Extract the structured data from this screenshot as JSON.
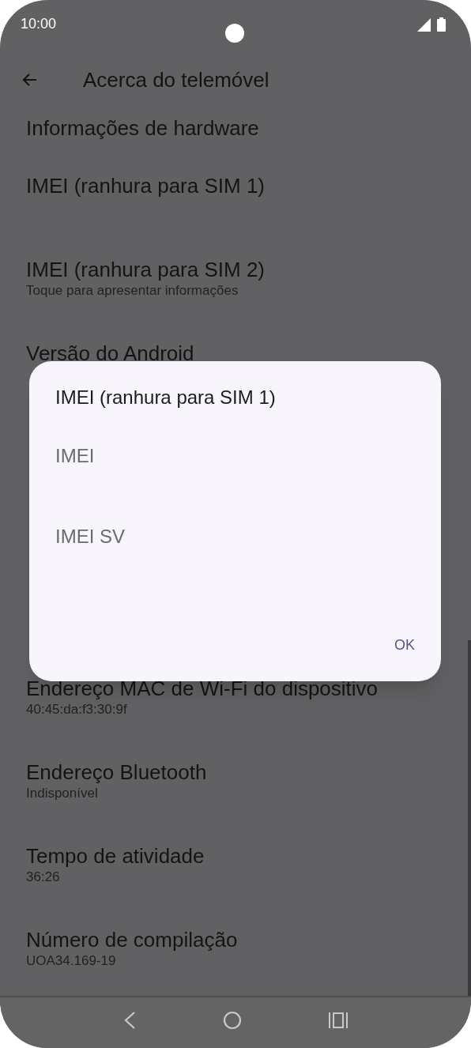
{
  "status_bar": {
    "time": "10:00"
  },
  "app_bar": {
    "title": "Acerca do telemóvel"
  },
  "settings": [
    {
      "kind": "header",
      "title": "Informações de hardware"
    },
    {
      "kind": "item",
      "title": "IMEI (ranhura para SIM 1)"
    },
    {
      "kind": "item",
      "title": "IMEI (ranhura para SIM 2)",
      "subtitle": "Toque para apresentar informações"
    },
    {
      "kind": "item",
      "title": "Versão do Android"
    },
    {
      "kind": "gap"
    },
    {
      "kind": "item",
      "title": "Endereço MAC de Wi-Fi do dispositivo",
      "subtitle": "40:45:da:f3:30:9f"
    },
    {
      "kind": "item",
      "title": "Endereço Bluetooth",
      "subtitle": "Indisponível"
    },
    {
      "kind": "item",
      "title": "Tempo de atividade",
      "subtitle": "36:26"
    },
    {
      "kind": "item",
      "title": "Número de compilação",
      "subtitle": "UOA34.169-19"
    }
  ],
  "dialog": {
    "title": "IMEI (ranhura para SIM 1)",
    "items": [
      "IMEI",
      "IMEI SV"
    ],
    "button": "OK"
  }
}
